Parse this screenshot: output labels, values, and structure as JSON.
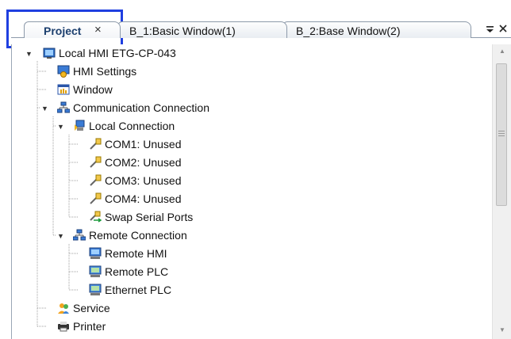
{
  "tabs": [
    {
      "label": "Project",
      "close": "×",
      "active": true
    },
    {
      "label": "B_1:Basic Window(1)",
      "active": false
    },
    {
      "label": "B_2:Base Window(2)",
      "active": false
    }
  ],
  "tab_menu_icon": "tab-menu-icon",
  "tree": [
    {
      "label": "Local HMI ETG-CP-043",
      "icon": "hmi-device-icon"
    },
    {
      "label": "HMI Settings",
      "icon": "settings-icon"
    },
    {
      "label": "Window",
      "icon": "window-icon"
    },
    {
      "label": "Communication Connection",
      "icon": "network-icon"
    },
    {
      "label": "Local Connection",
      "icon": "local-connection-icon"
    },
    {
      "label": "COM1: Unused",
      "icon": "serial-port-icon"
    },
    {
      "label": "COM2: Unused",
      "icon": "serial-port-icon"
    },
    {
      "label": "COM3: Unused",
      "icon": "serial-port-icon"
    },
    {
      "label": "COM4: Unused",
      "icon": "serial-port-icon"
    },
    {
      "label": "Swap Serial Ports",
      "icon": "swap-ports-icon"
    },
    {
      "label": "Remote Connection",
      "icon": "network-icon"
    },
    {
      "label": "Remote HMI",
      "icon": "remote-hmi-icon"
    },
    {
      "label": "Remote PLC",
      "icon": "remote-plc-icon"
    },
    {
      "label": "Ethernet PLC",
      "icon": "ethernet-plc-icon"
    },
    {
      "label": "Service",
      "icon": "service-icon"
    },
    {
      "label": "Printer",
      "icon": "printer-icon"
    }
  ],
  "colors": {
    "highlight": "#1f3fe0",
    "tab_border": "#8d9aaa",
    "active_tab_text": "#1c3f6e"
  }
}
